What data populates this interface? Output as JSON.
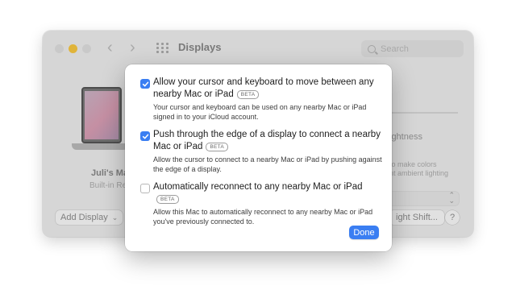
{
  "window": {
    "title": "Displays",
    "search_placeholder": "Search"
  },
  "display": {
    "name": "Juli's Ma",
    "subtitle": "Built-in Re",
    "add_display_label": "Add Display"
  },
  "right_panel": {
    "brightness_label": "ightness",
    "auto_line1": "to make colors",
    "auto_line2": "nt ambient lighting",
    "night_shift_label": "ight Shift...",
    "help_label": "?"
  },
  "sheet": {
    "options": [
      {
        "checked": true,
        "title": "Allow your cursor and keyboard to move between any nearby Mac or iPad",
        "badge": "BETA",
        "description": "Your cursor and keyboard can be used on any nearby Mac or iPad signed in to your iCloud account."
      },
      {
        "checked": true,
        "title": "Push through the edge of a display to connect a nearby Mac or iPad",
        "badge": "BETA",
        "description": "Allow the cursor to connect to a nearby Mac or iPad by pushing against the edge of a display."
      },
      {
        "checked": false,
        "title": "Automatically reconnect to any nearby Mac or iPad",
        "badge": "BETA",
        "description": "Allow this Mac to automatically reconnect to any nearby Mac or iPad you've previously connected to."
      }
    ],
    "done_label": "Done"
  },
  "colors": {
    "accent": "#3a7ef2",
    "window_bg": "#d6d6d6"
  }
}
